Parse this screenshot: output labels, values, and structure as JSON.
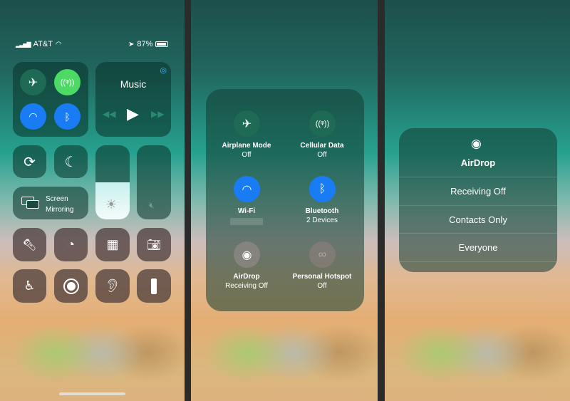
{
  "status": {
    "carrier": "AT&T",
    "battery": "87%",
    "battery_level": 0.87
  },
  "control_center": {
    "connectivity": {
      "airplane": false,
      "cellular": true,
      "wifi": true,
      "bluetooth": true
    },
    "music": {
      "title": "Music"
    },
    "screen_mirroring": {
      "line1": "Screen",
      "line2": "Mirroring"
    },
    "brightness_level": 0.5,
    "volume_level": 0.0,
    "colors": {
      "green": "#4cd964",
      "blue": "#1a7cf5"
    }
  },
  "expanded": {
    "items": [
      {
        "label": "Airplane Mode",
        "state": "Off",
        "icon": "airplane-icon"
      },
      {
        "label": "Cellular Data",
        "state": "Off",
        "icon": "cellular-icon"
      },
      {
        "label": "Wi-Fi",
        "state": "",
        "icon": "wifi-icon"
      },
      {
        "label": "Bluetooth",
        "state": "2 Devices",
        "icon": "bluetooth-icon"
      },
      {
        "label": "AirDrop",
        "state": "Receiving Off",
        "icon": "airdrop-icon"
      },
      {
        "label": "Personal Hotspot",
        "state": "Off",
        "icon": "hotspot-icon"
      }
    ]
  },
  "airdrop_menu": {
    "title": "AirDrop",
    "options": [
      "Receiving Off",
      "Contacts Only",
      "Everyone"
    ]
  }
}
